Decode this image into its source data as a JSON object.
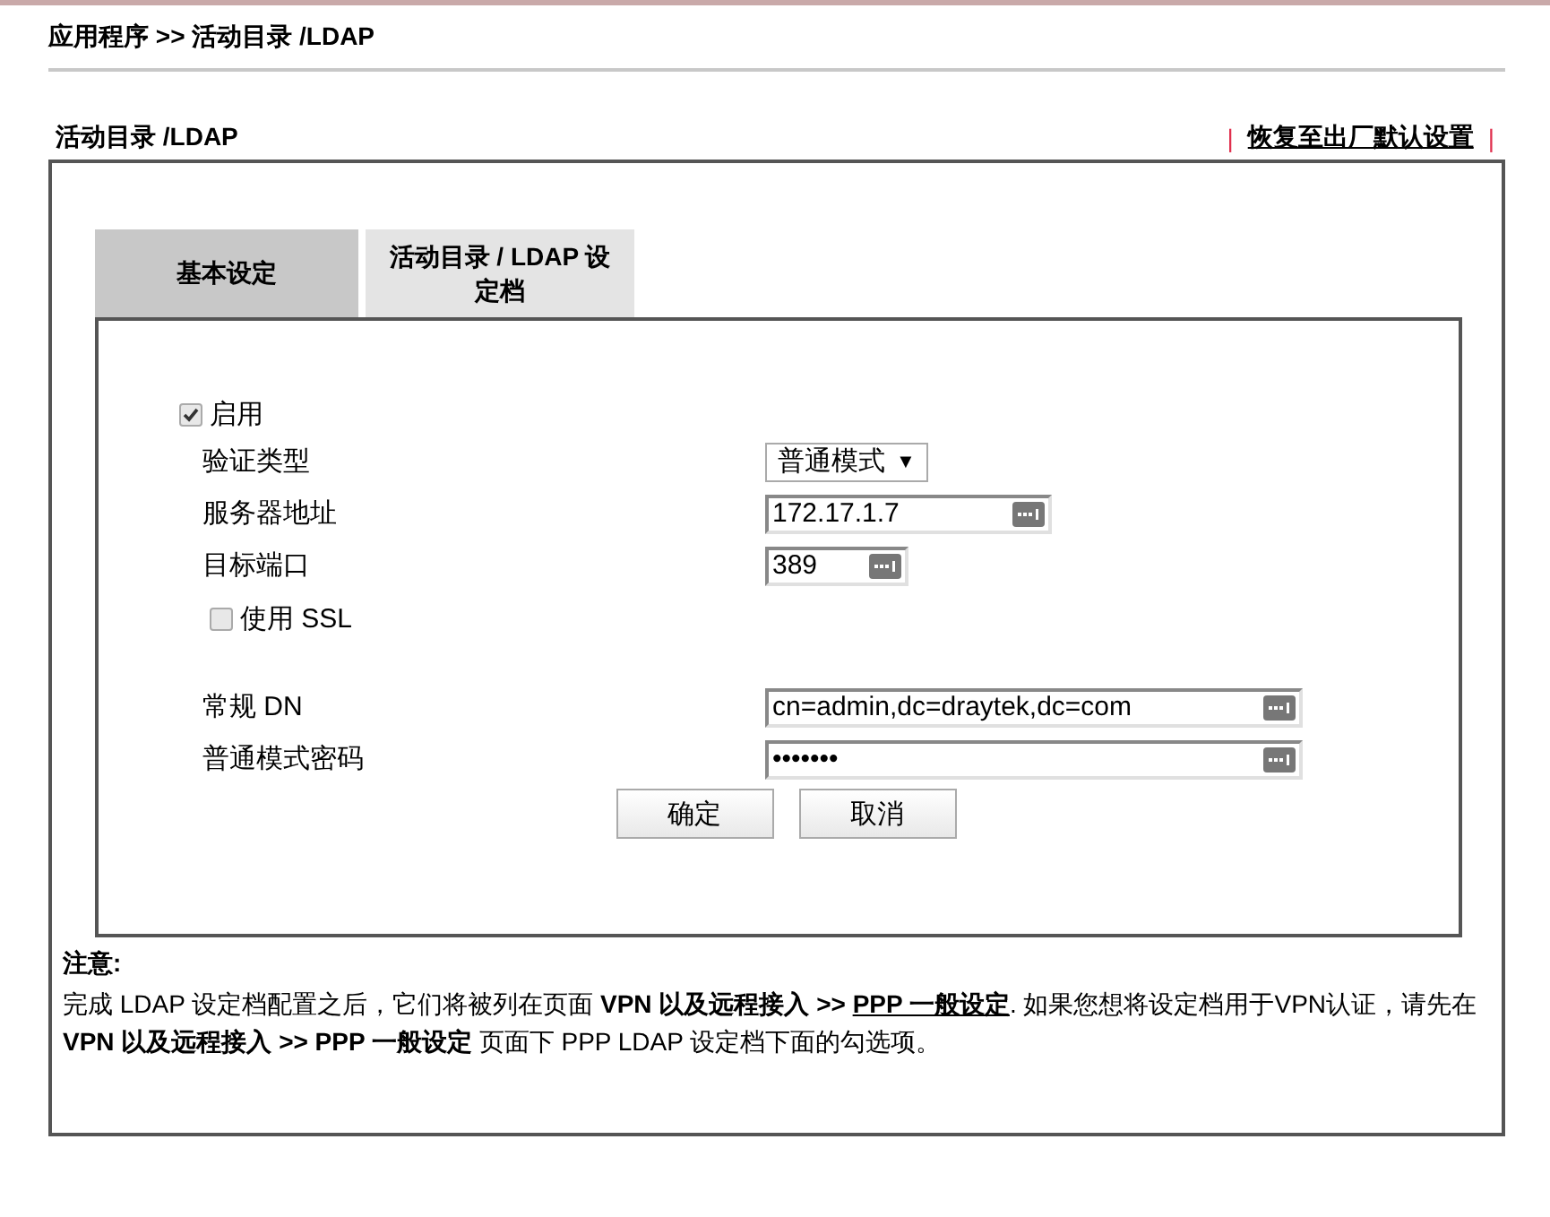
{
  "breadcrumb": "应用程序 >> 活动目录 /LDAP",
  "section": {
    "title": "活动目录 /LDAP",
    "separator_left": "|",
    "restore_link": "恢复至出厂默认设置",
    "separator_right": "|"
  },
  "tabs": [
    {
      "label": "基本设定",
      "selected": true
    },
    {
      "label": "活动目录 / LDAP 设定档",
      "selected": false
    }
  ],
  "form": [
    {
      "kind": "checkbox",
      "label": "启用",
      "checked": true
    },
    {
      "kind": "select",
      "label": "验证类型",
      "value": "普通模式",
      "caret": "▼"
    },
    {
      "kind": "text",
      "label": "服务器地址",
      "value": "172.17.1.7"
    },
    {
      "kind": "text",
      "label": "目标端口",
      "value": "389"
    },
    {
      "kind": "checkbox",
      "label": "使用 SSL",
      "checked": false
    },
    {
      "kind": "spacer"
    },
    {
      "kind": "text",
      "label": "常规 DN",
      "value": "cn=admin,dc=draytek,dc=com"
    },
    {
      "kind": "password",
      "label": "普通模式密码",
      "value": "•••••••"
    }
  ],
  "buttons": [
    "确定",
    "取消"
  ],
  "note": {
    "title": "注意:",
    "text_before": "完成 LDAP 设定档配置之后，它们将被列在页面 **VPN 以及远程接入 >>** ",
    "link": "PPP 一般设定",
    "text_after": ". 如果您想将设定档用于VPN认证，请先在 **VPN 以及远程接入 >> PPP 一般设定** 页面下 PPP LDAP 设定档下面的勾选项。"
  }
}
